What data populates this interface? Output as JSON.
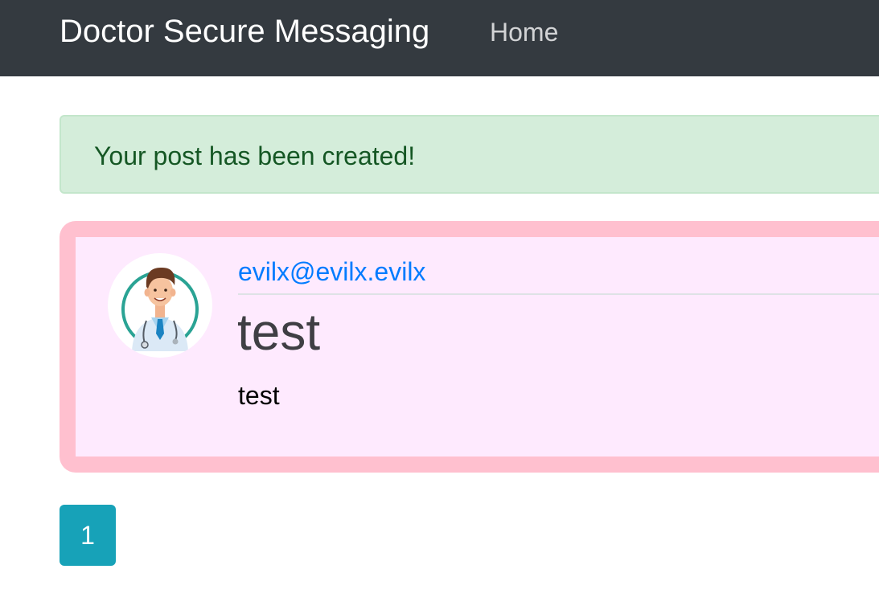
{
  "navbar": {
    "brand": "Doctor Secure Messaging",
    "home_label": "Home"
  },
  "alert": {
    "message": "Your post has been created!",
    "color": "#d4edda"
  },
  "post": {
    "author": "evilx@evilx.evilx",
    "title": "test",
    "content": "test",
    "avatar_icon": "doctor-avatar-icon",
    "border_color": "#ffc0cf",
    "background_color": "#feeafe"
  },
  "pagination": {
    "pages": [
      "1"
    ],
    "current": "1",
    "accent": "#17a2b8"
  }
}
